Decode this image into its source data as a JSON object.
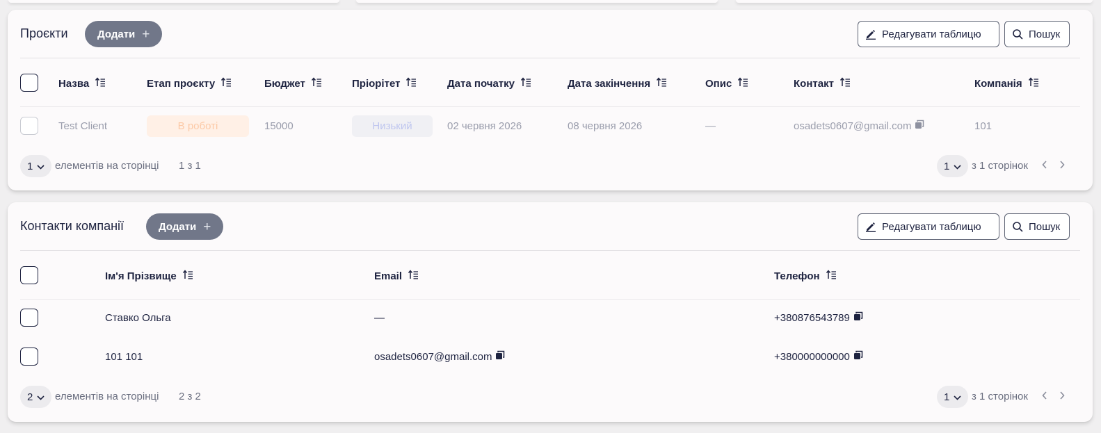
{
  "projects": {
    "title": "Проєкти",
    "add_label": "Додати",
    "edit_table_label": "Редагувати таблицю",
    "search_label": "Пошук",
    "columns": [
      "Назва",
      "Етап проєкту",
      "Бюджет",
      "Пріорітет",
      "Дата початку",
      "Дата закінчення",
      "Опис",
      "Контакт",
      "Компанія"
    ],
    "rows": [
      {
        "name": "Test Client",
        "stage": "В роботі",
        "budget": "15000",
        "priority": "Низький",
        "start_date": "02 червня 2026",
        "end_date": "08 червня 2026",
        "description": "—",
        "contact": "osadets0607@gmail.com",
        "company": "101"
      }
    ],
    "footer": {
      "per_page": "1",
      "per_page_label": "елементів на сторінці",
      "range": "1 з 1",
      "page": "1",
      "pages_label": "з 1 сторінок"
    }
  },
  "contacts": {
    "title": "Контакти компанії",
    "add_label": "Додати",
    "edit_table_label": "Редагувати таблицю",
    "search_label": "Пошук",
    "columns": [
      "Ім'я Прізвище",
      "Email",
      "Телефон"
    ],
    "rows": [
      {
        "name": "Ставко Ольга",
        "email": "—",
        "phone": "+380876543789"
      },
      {
        "name": "101 101",
        "email": "osadets0607@gmail.com",
        "phone": "+380000000000"
      }
    ],
    "footer": {
      "per_page": "2",
      "per_page_label": "елементів на сторінці",
      "range": "2 з 2",
      "page": "1",
      "pages_label": "з 1 сторінок"
    }
  },
  "colors": {
    "add_button": "#717789",
    "text": "#1e2340",
    "stage_bg": "#fff0e6",
    "stage_text": "#fcc9a6",
    "priority_bg": "#f0f0f4",
    "priority_text": "#bfc6ef"
  },
  "icons": {
    "edit": "pencil-icon",
    "search": "search-icon",
    "sort": "sort-icon",
    "copy": "copy-icon",
    "add": "plus-icon",
    "dropdown": "chevron-down-icon",
    "prev": "chevron-left-icon",
    "next": "chevron-right-icon"
  }
}
